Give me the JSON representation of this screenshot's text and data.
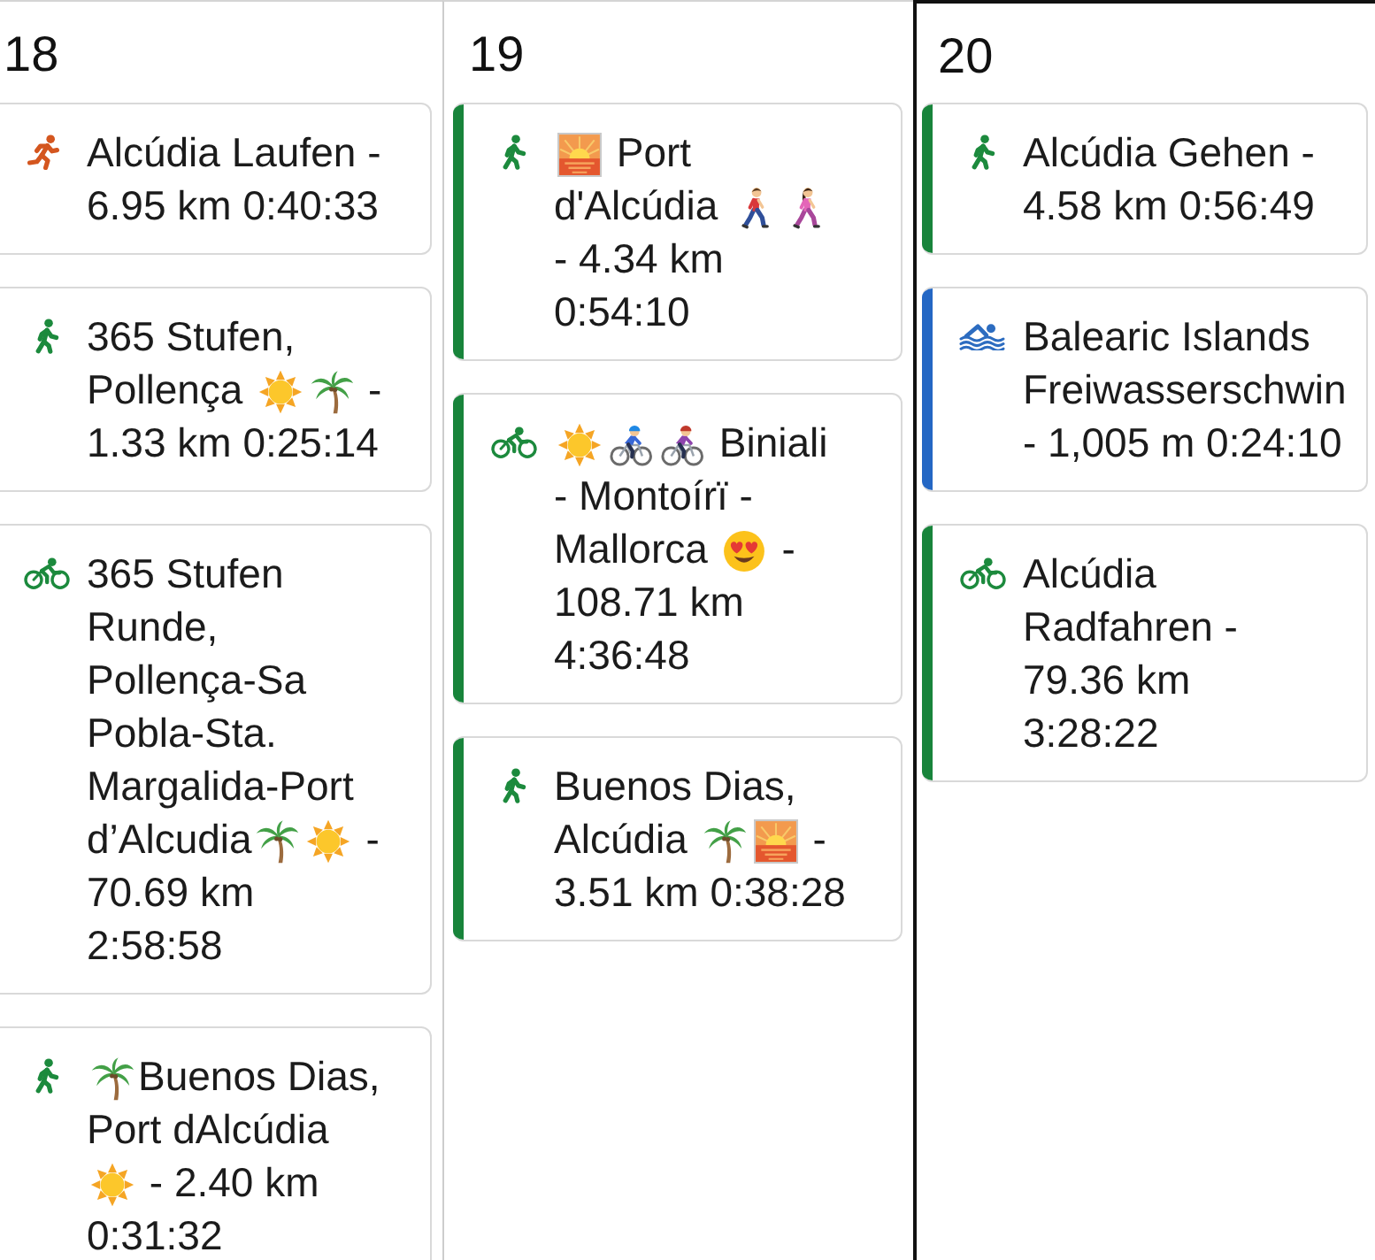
{
  "days": [
    {
      "number": "18",
      "today": false,
      "activities": [
        {
          "kind": "run",
          "title": [
            {
              "kind": "text",
              "text": "Alcúdia Laufen - 6.95 km 0:40:33"
            }
          ]
        },
        {
          "kind": "walk",
          "title": [
            {
              "kind": "text",
              "text": "365 Stufen, Pollença "
            },
            {
              "kind": "sun"
            },
            {
              "kind": "palm"
            },
            {
              "kind": "text",
              "text": " - 1.33 km 0:25:14"
            }
          ]
        },
        {
          "kind": "bike",
          "title": [
            {
              "kind": "text",
              "text": "365 Stufen Runde, Pollença-Sa Pobla-Sta. Margalida-Port d’Alcudia"
            },
            {
              "kind": "palm"
            },
            {
              "kind": "sun"
            },
            {
              "kind": "text",
              "text": " - 70.69 km 2:58:58"
            }
          ]
        },
        {
          "kind": "walk",
          "title": [
            {
              "kind": "palm"
            },
            {
              "kind": "text",
              "text": "Buenos Dias, Port dAlcúdia "
            },
            {
              "kind": "sun"
            },
            {
              "kind": "text",
              "text": " - 2.40 km 0:31:32"
            }
          ]
        }
      ]
    },
    {
      "number": "19",
      "today": false,
      "activities": [
        {
          "kind": "walk",
          "color": "#18843b",
          "title": [
            {
              "kind": "sunrise"
            },
            {
              "kind": "text",
              "text": " Port d'Alcúdia "
            },
            {
              "kind": "walkingman"
            },
            {
              "kind": "walkingwoman"
            },
            {
              "kind": "text",
              "text": " - 4.34 km 0:54:10"
            }
          ]
        },
        {
          "kind": "bike",
          "color": "#18843b",
          "title": [
            {
              "kind": "sun"
            },
            {
              "kind": "cyclistblue"
            },
            {
              "kind": "cyclistpurple"
            },
            {
              "kind": "text",
              "text": " Biniali - Montoírï - Mallorca "
            },
            {
              "kind": "hearteyes"
            },
            {
              "kind": "text",
              "text": " - 108.71 km 4:36:48"
            }
          ]
        },
        {
          "kind": "walk",
          "color": "#18843b",
          "title": [
            {
              "kind": "text",
              "text": "Buenos Dias, Alcúdia "
            },
            {
              "kind": "palm"
            },
            {
              "kind": "sunrise"
            },
            {
              "kind": "text",
              "text": " - 3.51 km 0:38:28"
            }
          ]
        }
      ]
    },
    {
      "number": "20",
      "today": true,
      "activities": [
        {
          "kind": "walk",
          "color": "#18843b",
          "title": [
            {
              "kind": "text",
              "text": "Alcúdia Gehen - 4.58 km 0:56:49"
            }
          ]
        },
        {
          "kind": "swim",
          "color": "#2467c4",
          "title": [
            {
              "kind": "text",
              "text": "Balearic Islands Freiwasserschwin - 1,005 m 0:24:10"
            }
          ]
        },
        {
          "kind": "bike",
          "color": "#18843b",
          "title": [
            {
              "kind": "text",
              "text": "Alcúdia Radfahren - 79.36 km 3:28:22"
            }
          ]
        }
      ]
    }
  ]
}
